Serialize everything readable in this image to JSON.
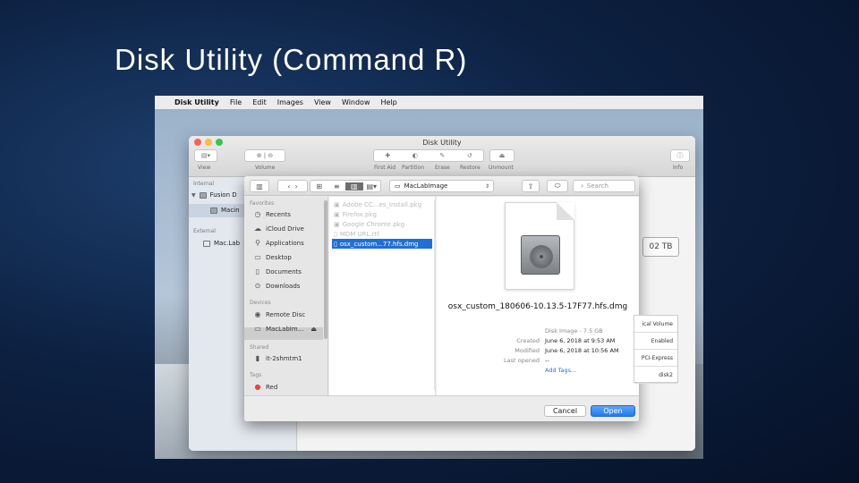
{
  "slide": {
    "title": "Disk Utility (Command R)"
  },
  "menubar": {
    "apple": "",
    "app": "Disk Utility",
    "items": [
      "File",
      "Edit",
      "Images",
      "View",
      "Window",
      "Help"
    ]
  },
  "du_window": {
    "title": "Disk Utility",
    "toolbar": {
      "view": "View",
      "volume": "Volume",
      "first_aid": "First Aid",
      "partition": "Partition",
      "erase": "Erase",
      "restore": "Restore",
      "unmount": "Unmount",
      "info": "Info"
    },
    "sidebar": {
      "internal_heading": "Internal",
      "internal_items": [
        "Fusion D",
        "Macin"
      ],
      "external_heading": "External",
      "external_items": [
        "Mac.Lab"
      ]
    },
    "capacity": "02 TB",
    "info_rows": [
      "ical Volume",
      "Enabled",
      "PCI-Express",
      "disk2"
    ]
  },
  "open_dialog": {
    "location": "MacLabImage",
    "search_placeholder": "Search",
    "sidebar": {
      "favorites_heading": "Favorites",
      "favorites": [
        "Recents",
        "iCloud Drive",
        "Applications",
        "Desktop",
        "Documents",
        "Downloads"
      ],
      "devices_heading": "Devices",
      "devices": [
        "Remote Disc",
        "MacLabIm..."
      ],
      "shared_heading": "Shared",
      "shared": [
        "it-2shmtm1"
      ],
      "tags_heading": "Tags",
      "tags": [
        "Red"
      ]
    },
    "files": [
      {
        "name": "Adobe CC...es_Install.pkg",
        "selected": false
      },
      {
        "name": "Firefox.pkg",
        "selected": false
      },
      {
        "name": "Google Chrome.pkg",
        "selected": false
      },
      {
        "name": "MDM URL.rtf",
        "selected": false
      },
      {
        "name": "osx_custom...77.hfs.dmg",
        "selected": true
      }
    ],
    "preview": {
      "filename": "osx_custom_180606-10.13.5-17F77.hfs.dmg",
      "kind": "Disk Image - 7.5 GB",
      "created_label": "Created",
      "created": "June 6, 2018 at 9:53 AM",
      "modified_label": "Modified",
      "modified": "June 6, 2018 at 10:56 AM",
      "last_opened_label": "Last opened",
      "last_opened": "--",
      "add_tags": "Add Tags..."
    },
    "buttons": {
      "cancel": "Cancel",
      "open": "Open"
    }
  },
  "colors": {
    "accent": "#1f7cf2",
    "selection": "#1f6fd6",
    "tag_red": "#e8453c"
  }
}
